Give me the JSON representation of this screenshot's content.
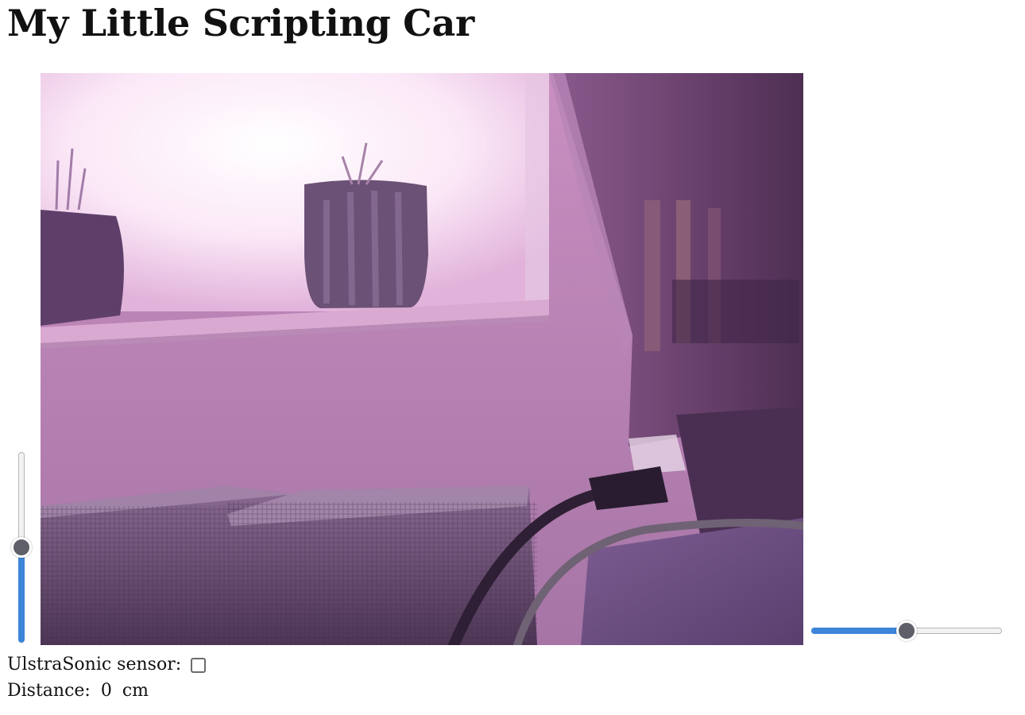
{
  "page": {
    "title": "My Little Scripting Car"
  },
  "controls": {
    "vertical_slider": {
      "value": 0.5
    },
    "horizontal_slider": {
      "value": 0.5
    }
  },
  "camera": {
    "icon": "camera-feed-image"
  },
  "sensor": {
    "label": "UlstraSonic sensor:",
    "checked": false
  },
  "distance": {
    "label": "Distance:",
    "value": "0",
    "unit": "cm"
  },
  "colors": {
    "accent": "#3d85d8",
    "thumb": "#5e5f68"
  }
}
